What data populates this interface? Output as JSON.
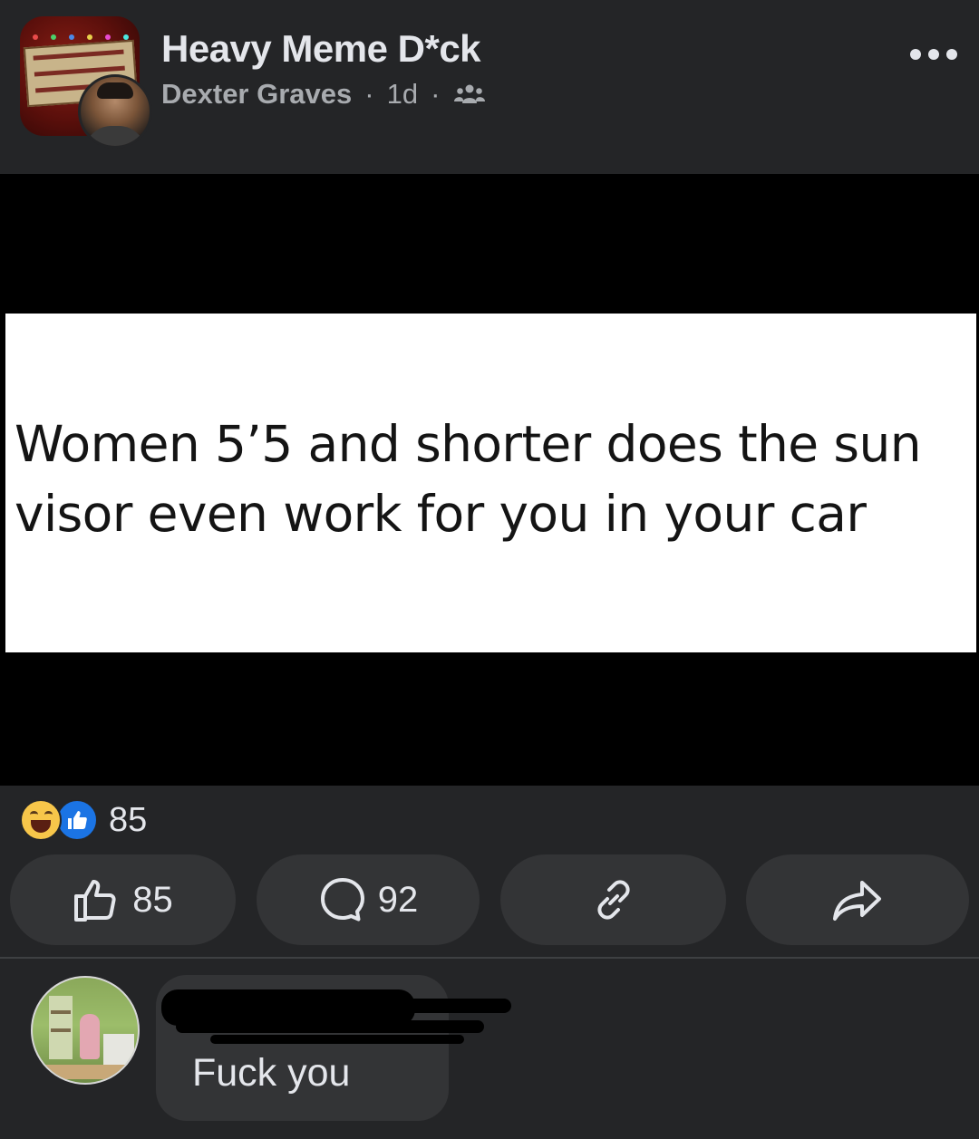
{
  "post": {
    "group_name": "Heavy Meme D*ck",
    "author": "Dexter Graves",
    "separator": "·",
    "time": "1d",
    "audience_icon": "group-icon",
    "menu_icon": "more-icon",
    "group_avatar_sign": [
      "PLEASE DO",
      "NOT FEED",
      "WHORES"
    ]
  },
  "media": {
    "text": "Women 5’5 and shorter does the sun visor even work for you in your car"
  },
  "reactions": {
    "types": [
      "haha",
      "like"
    ],
    "count": "85"
  },
  "actions": {
    "like_count": "85",
    "comment_count": "92",
    "like_icon": "thumbs-up-icon",
    "comment_icon": "comment-icon",
    "link_icon": "link-icon",
    "share_icon": "share-icon"
  },
  "comment": {
    "author_redacted": true,
    "text": "Fuck you"
  },
  "colors": {
    "background": "#242527",
    "button": "#333436",
    "text": "#e4e6eb",
    "secondary": "#a8abaf",
    "like_blue": "#1b74e4",
    "haha_yellow": "#f7c64a"
  }
}
